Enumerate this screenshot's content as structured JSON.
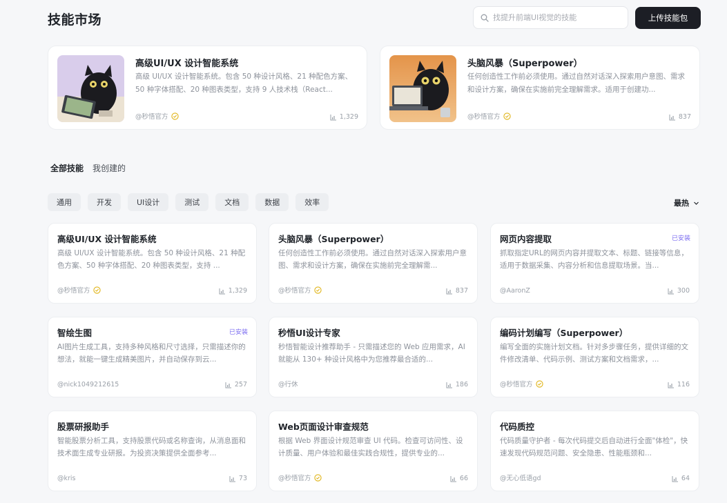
{
  "header": {
    "title": "技能市场",
    "search_placeholder": "找提升前端UI视觉的技能",
    "upload_label": "上传技能包"
  },
  "featured": [
    {
      "title": "高级UI/UX 设计智能系统",
      "desc": "高级 UI/UX 设计智能系统。包含 50 种设计风格、21 种配色方案、50 种字体搭配、20 种图表类型，支持 9 人技术栈（React...",
      "author": "@秒悟官方",
      "verified": true,
      "count": "1,329"
    },
    {
      "title": "头脑风暴（Superpower）",
      "desc": "任何创造性工作前必须使用。通过自然对话深入探索用户意图、需求和设计方案，确保在实施前完全理解需求。适用于创建功...",
      "author": "@秒悟官方",
      "verified": true,
      "count": "837"
    }
  ],
  "tabs": [
    "全部技能",
    "我创建的"
  ],
  "categories": [
    "通用",
    "开发",
    "UI设计",
    "测试",
    "文档",
    "数据",
    "效率"
  ],
  "sort_label": "最热",
  "skills": [
    {
      "title": "高级UI/UX 设计智能系统",
      "badge": "",
      "desc": "高级 UI/UX 设计智能系统。包含 50 种设计风格、21 种配色方案、50 种字体搭配、20 种图表类型，支持 ...",
      "author": "@秒悟官方",
      "verified": true,
      "count": "1,329"
    },
    {
      "title": "头脑风暴（Superpower）",
      "badge": "",
      "desc": "任何创造性工作前必须使用。通过自然对话深入探索用户意图、需求和设计方案，确保在实施前完全理解需...",
      "author": "@秒悟官方",
      "verified": true,
      "count": "837"
    },
    {
      "title": "网页内容提取",
      "badge": "已安装",
      "desc": "抓取指定URL的网页内容并提取文本、标题、链接等信息，适用于数据采集、内容分析和信息提取场景。当...",
      "author": "@AaronZ",
      "verified": false,
      "count": "300"
    },
    {
      "title": "智绘生图",
      "badge": "已安装",
      "desc": "AI图片生成工具，支持多种风格和尺寸选择，只需描述你的想法，就能一键生成精美图片，并自动保存到云...",
      "author": "@nick1049212615",
      "verified": false,
      "count": "257"
    },
    {
      "title": "秒悟UI设计专家",
      "badge": "",
      "desc": "秒悟智能设计推荐助手 - 只需描述您的 Web 应用需求，AI 就能从 130+ 种设计风格中为您推荐最合适的...",
      "author": "@行休",
      "verified": false,
      "count": "186"
    },
    {
      "title": "编码计划编写（Superpower）",
      "badge": "",
      "desc": "编写全面的实施计划文档。针对多步骤任务，提供详细的文件修改清单、代码示例、测试方案和文档需求，...",
      "author": "@秒悟官方",
      "verified": true,
      "count": "116"
    },
    {
      "title": "股票研报助手",
      "badge": "",
      "desc": "智能股票分析工具，支持股票代码或名称查询，从消息面和技术面生成专业研报。为投资决策提供全面参考...",
      "author": "@kris",
      "verified": false,
      "count": "73"
    },
    {
      "title": "Web页面设计审查规范",
      "badge": "",
      "desc": "根据 Web 界面设计规范审查 UI 代码。检查可访问性、设计质量、用户体验和最佳实践合规性，提供专业的...",
      "author": "@秒悟官方",
      "verified": true,
      "count": "66"
    },
    {
      "title": "代码质控",
      "badge": "",
      "desc": "代码质量守护者 - 每次代码提交后自动进行全面\"体检\"，快速发现代码规范问题、安全隐患、性能瓶颈和...",
      "author": "@无心低语gd",
      "verified": false,
      "count": "64"
    }
  ]
}
